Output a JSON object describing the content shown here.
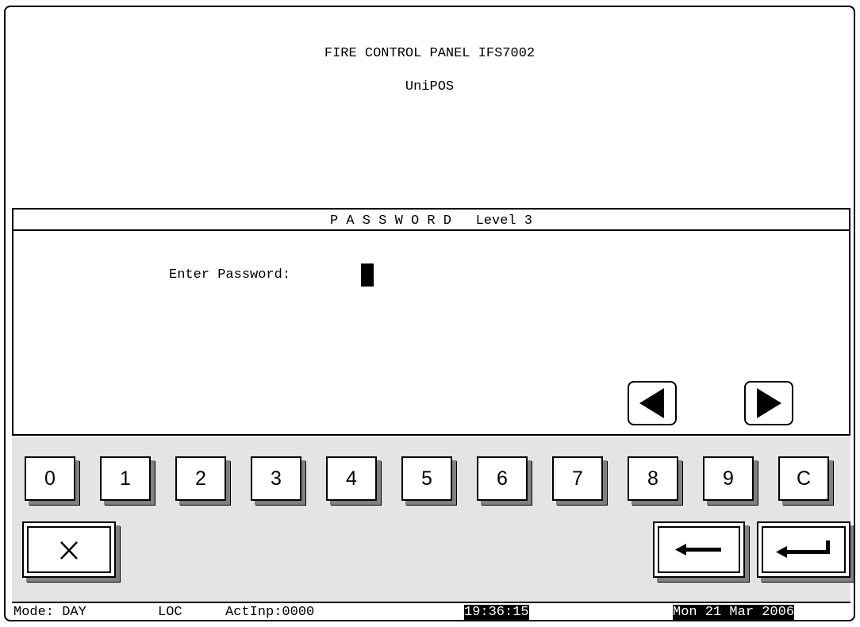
{
  "header": {
    "title_line1": "FIRE CONTROL PANEL  IFS7002",
    "title_line2": "UniPOS"
  },
  "dialog": {
    "title": "P A S S W O R D   Level 3",
    "prompt_label": "Enter Password:",
    "prev_icon": "triangle-left-icon",
    "next_icon": "triangle-right-icon"
  },
  "keypad": {
    "keys": [
      "0",
      "1",
      "2",
      "3",
      "4",
      "5",
      "6",
      "7",
      "8",
      "9",
      "C"
    ],
    "cancel_icon": "close-x-icon",
    "backspace_icon": "arrow-left-icon",
    "enter_icon": "enter-return-icon"
  },
  "status_bar": {
    "mode": "Mode: DAY",
    "loc": "LOC",
    "active_inputs": "ActInp:0000",
    "time": "19:36:15",
    "date": "Mon 21 Mar 2006"
  },
  "colors": {
    "keypad_background": "#e4e4e4",
    "key_shadow": "#808080",
    "highlight_background": "#000000",
    "highlight_text": "#ffffff"
  }
}
